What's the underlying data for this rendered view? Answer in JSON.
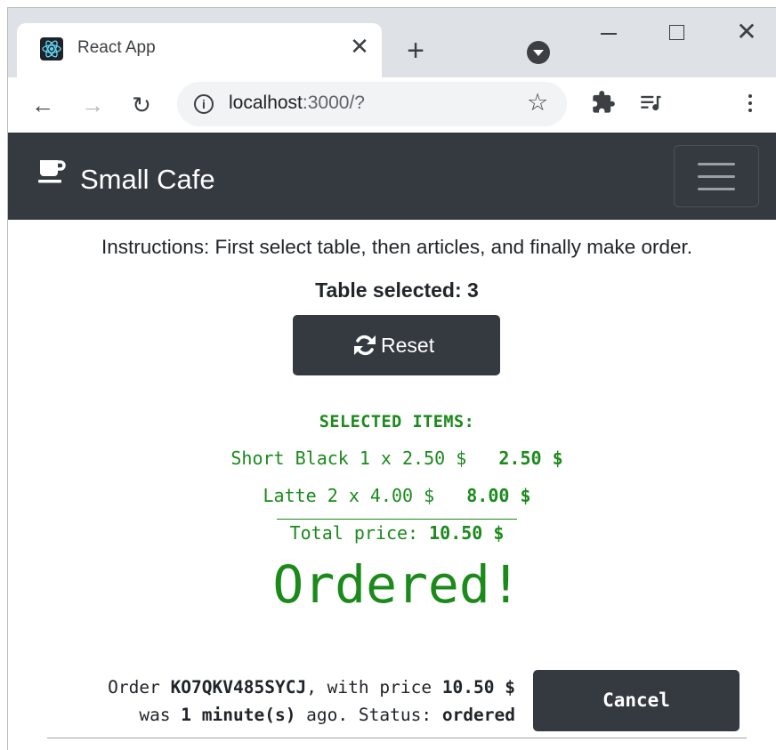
{
  "browser": {
    "tab_title": "React App",
    "tab_close": "✕",
    "new_tab": "+",
    "window_close": "✕",
    "back_glyph": "←",
    "forward_glyph": "→",
    "reload_glyph": "↻",
    "url_host": "localhost",
    "url_path": ":3000/?",
    "info_glyph": "i",
    "star_glyph": "☆",
    "icons": [
      "react-favicon",
      "profile-dropdown-icon",
      "minimize-icon",
      "maximize-icon",
      "close-icon",
      "back-arrow-icon",
      "forward-arrow-icon",
      "reload-icon",
      "info-icon",
      "star-icon",
      "extensions-icon",
      "media-queue-icon",
      "more-menu-icon"
    ]
  },
  "navbar": {
    "brand": "Small Cafe",
    "brand_icon": "coffee-cup-icon",
    "toggler_icon": "hamburger-icon"
  },
  "main": {
    "instructions": "Instructions: First select table, then articles, and finally make order.",
    "table_selected": "Table selected: 3",
    "reset_label": "Reset",
    "reset_icon": "sync-icon",
    "selected_title": "SELECTED ITEMS:",
    "items": [
      {
        "name": "Short Black",
        "qty": "1",
        "unit_price": "2.50 $",
        "line_text": "Short Black 1 x 2.50 $   ",
        "line_total": "2.50 $"
      },
      {
        "name": "Latte",
        "qty": "2",
        "unit_price": "4.00 $",
        "line_text": "Latte 2 x 4.00 $   ",
        "line_total": "8.00 $"
      }
    ],
    "total_label": "Total price: ",
    "total_value": "10.50 $",
    "status_heading": "Ordered!",
    "order": {
      "prefix": "Order ",
      "id": "KO7QKV485SYCJ",
      "mid": ", with price ",
      "price": "10.50 $",
      "was": "was ",
      "ago_value": "1 minute(s)",
      "ago_suffix": " ago. Status: ",
      "status": "ordered"
    },
    "cancel_label": "Cancel"
  },
  "colors": {
    "navbar_bg": "#343a40",
    "success_green": "#1b8a1b",
    "tabstrip_bg": "#dee1e6"
  }
}
